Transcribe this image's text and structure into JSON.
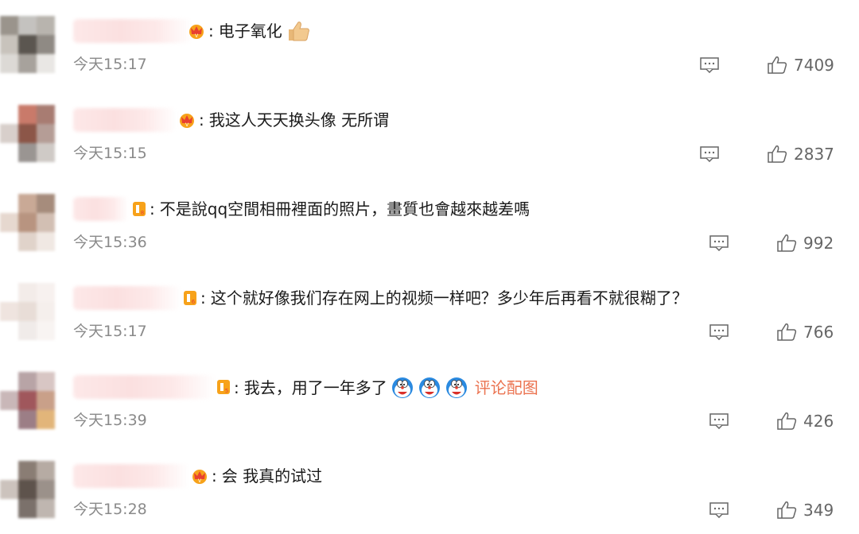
{
  "comments": [
    {
      "text": "电子氧化",
      "time": "今天15:17",
      "likes": "7409",
      "badge": "crown-badge",
      "emojis": [
        "thumbs-up-icon"
      ],
      "pic_link": ""
    },
    {
      "text": "我这人天天换头像 无所谓",
      "time": "今天15:15",
      "likes": "2837",
      "badge": "crown-badge",
      "emojis": [],
      "pic_link": ""
    },
    {
      "text": "不是說qq空間相冊裡面的照片，畫質也會越來越差嗎",
      "time": "今天15:36",
      "likes": "992",
      "badge": "level-badge",
      "emojis": [],
      "pic_link": ""
    },
    {
      "text": "这个就好像我们存在网上的视频一样吧？多少年后再看不就很糊了？",
      "time": "今天15:17",
      "likes": "766",
      "badge": "level-badge",
      "emojis": [],
      "pic_link": ""
    },
    {
      "text": "我去，用了一年多了",
      "time": "今天15:39",
      "likes": "426",
      "badge": "level-badge",
      "emojis": [
        "doraemon-icon",
        "doraemon-icon",
        "doraemon-icon"
      ],
      "pic_link": "评论配图"
    },
    {
      "text": "会 我真的试过",
      "time": "今天15:28",
      "likes": "349",
      "badge": "crown-badge",
      "emojis": [],
      "pic_link": ""
    }
  ],
  "colors": {
    "link": "#eb7350",
    "badge_orange": "#f7a21a",
    "badge_red": "#e8412f",
    "meta_gray": "#8a8a8a"
  }
}
